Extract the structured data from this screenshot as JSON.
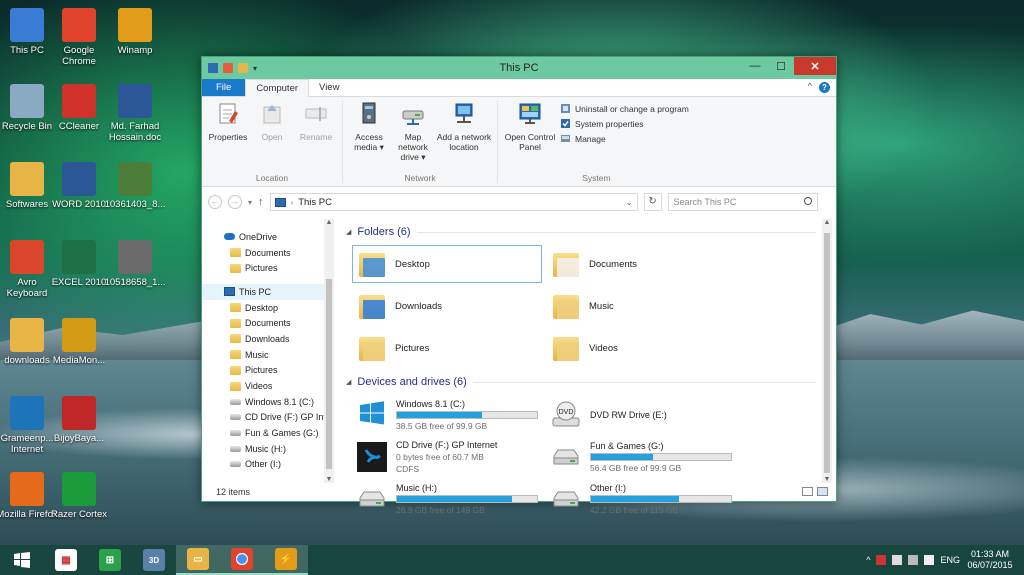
{
  "desktop_icons": [
    {
      "label": "This PC",
      "x": 0,
      "y": 0,
      "color": "#3a7bd5"
    },
    {
      "label": "Google Chrome",
      "color": "#e0442c"
    },
    {
      "label": "Winamp",
      "color": "#e39b1a"
    },
    {
      "label": "Recycle Bin",
      "color": "#8aa9c2"
    },
    {
      "label": "CCleaner",
      "color": "#d0322b"
    },
    {
      "label": "Md. Farhad Hossain.doc",
      "color": "#2b5797"
    },
    {
      "label": "Softwares",
      "color": "#e6b546"
    },
    {
      "label": "WORD 2010",
      "color": "#2b5797"
    },
    {
      "label": "10361403_8...",
      "color": "#4c7d3a"
    },
    {
      "label": "Avro Keyboard",
      "color": "#d9462a"
    },
    {
      "label": "EXCEL 2010",
      "color": "#1e7145"
    },
    {
      "label": "10518658_1...",
      "color": "#6b6b6b"
    },
    {
      "label": "downloads",
      "color": "#e6b546"
    },
    {
      "label": "MediaMon...",
      "color": "#d39a16"
    },
    {
      "label": "Grameenp... Internet",
      "color": "#1d74b8"
    },
    {
      "label": "BijoyBaya...",
      "color": "#c02828"
    },
    {
      "label": "Mozilla Firefox",
      "color": "#e66a1c"
    },
    {
      "label": "Razer Cortex",
      "color": "#1a9c3a"
    }
  ],
  "window": {
    "title": "This PC",
    "tabs": [
      "File",
      "Computer",
      "View"
    ],
    "ribbon": {
      "location": {
        "label": "Location",
        "buttons": [
          "Properties",
          "Open",
          "Rename"
        ]
      },
      "network": {
        "label": "Network",
        "buttons": [
          "Access media ▾",
          "Map network drive ▾",
          "Add a network location"
        ]
      },
      "system": {
        "label": "System",
        "open_cp": "Open Control Panel",
        "small": [
          "Uninstall or change a program",
          "System properties",
          "Manage"
        ]
      }
    },
    "address": "This PC",
    "search_placeholder": "Search This PC",
    "nav": {
      "onedrive": "OneDrive",
      "onedrive_children": [
        "Documents",
        "Pictures"
      ],
      "thispc": "This PC",
      "thispc_children": [
        "Desktop",
        "Documents",
        "Downloads",
        "Music",
        "Pictures",
        "Videos"
      ],
      "drives": [
        "Windows 8.1 (C:)",
        "CD Drive (F:) GP Int",
        "Fun & Games (G:)",
        "Music (H:)",
        "Other (I:)"
      ]
    },
    "folders_header": "Folders (6)",
    "folders": [
      "Desktop",
      "Documents",
      "Downloads",
      "Music",
      "Pictures",
      "Videos"
    ],
    "drives_header": "Devices and drives (6)",
    "drives": [
      {
        "name": "Windows 8.1 (C:)",
        "free": "38.5 GB free of 99.9 GB",
        "used_fraction": 0.61,
        "kind": "windows"
      },
      {
        "name": "DVD RW Drive (E:)",
        "free": "",
        "used_fraction": null,
        "kind": "dvd"
      },
      {
        "name": "CD Drive (F:) GP Internet",
        "free": "0 bytes free of 60.7 MB",
        "fs": "CDFS",
        "used_fraction": null,
        "kind": "gp"
      },
      {
        "name": "Fun & Games (G:)",
        "free": "56.4 GB free of 99.9 GB",
        "used_fraction": 0.44,
        "kind": "hdd"
      },
      {
        "name": "Music (H:)",
        "free": "26.9 GB free of 149 GB",
        "used_fraction": 0.82,
        "kind": "hdd"
      },
      {
        "name": "Other (I:)",
        "free": "42.2 GB free of 115 GB",
        "used_fraction": 0.63,
        "kind": "hdd"
      }
    ],
    "status": "12 items"
  },
  "taskbar": {
    "apps": [
      "start-icon",
      "store-icon",
      "windows-store-icon",
      "3dm-icon",
      "file-explorer-icon",
      "chrome-icon",
      "winamp-icon"
    ],
    "tray_lang": "ENG",
    "time": "01:33 AM",
    "date": "06/07/2015"
  }
}
